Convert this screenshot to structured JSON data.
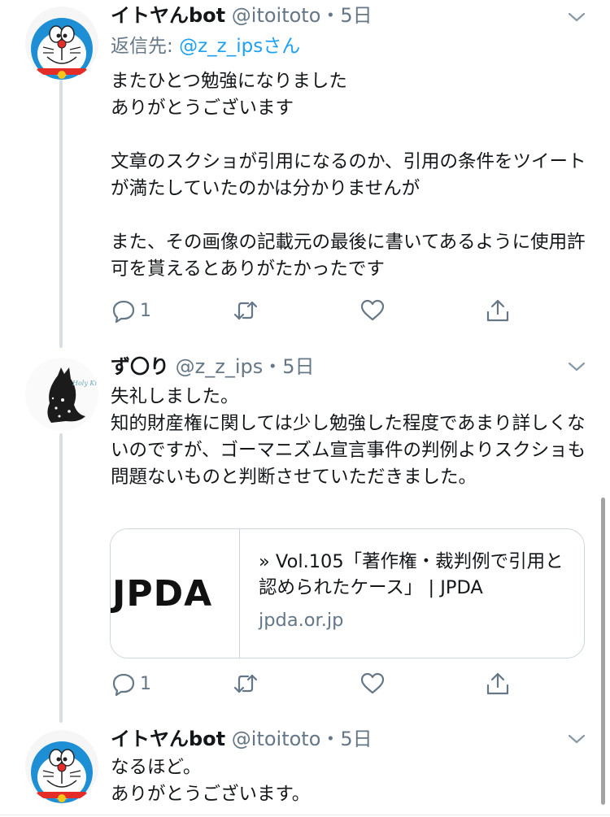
{
  "tweets": [
    {
      "display_name": "イトヤんbot",
      "handle": "@itoitoto",
      "time": "・5日",
      "reply_prefix": "返信先: ",
      "reply_handle": "@z_z_ips",
      "reply_suffix": "さん",
      "text": "またひとつ勉強になりました\nありがとうございます\n\n文章のスクショが引用になるのか、引用の条件をツイートが満たしていたのかは分かりませんが\n\nまた、その画像の記載元の最後に書いてあるように使用許可を貰えるとありがたかったです",
      "reply_count": "1",
      "avatar_icon": "doraemon-avatar-icon"
    },
    {
      "display_name": "ず〇り",
      "handle": "@z_z_ips",
      "time": "・5日",
      "text": "失礼しました。\n知的財産権に関しては少し勉強した程度であまり詳しくないのですが、ゴーマニズム宣言事件の判例よりスクショも問題ないものと判断させていただきました。",
      "reply_count": "1",
      "avatar_icon": "holy-knight-cat-avatar-icon",
      "avatar_text": "Holy Knight",
      "card": {
        "image_text": "JPDA",
        "title": "» Vol.105「著作権・裁判例で引用と認められたケース」 | JPDA",
        "domain": "jpda.or.jp"
      }
    },
    {
      "display_name": "イトヤんbot",
      "handle": "@itoitoto",
      "time": "・5日",
      "text": "なるほど。\nありがとうございます。",
      "avatar_icon": "doraemon-avatar-icon"
    }
  ],
  "colors": {
    "text": "#14171a",
    "secondary": "#657786",
    "link": "#1da1f2",
    "thread_line": "#d6dfe5"
  }
}
